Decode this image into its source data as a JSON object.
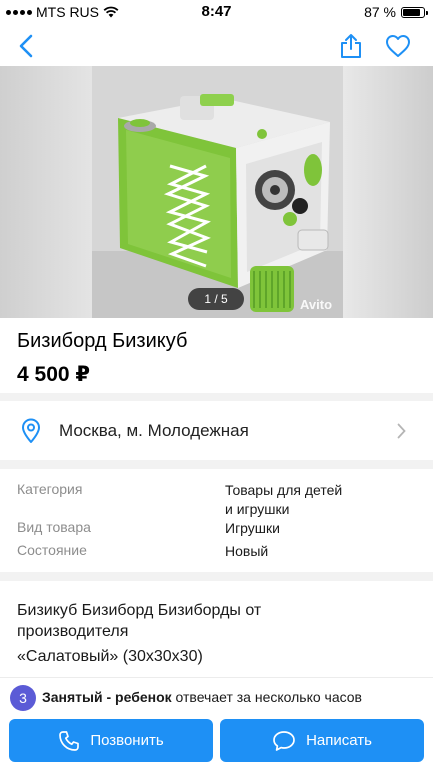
{
  "status": {
    "carrier": "MTS RUS",
    "time": "8:47",
    "battery_percent": "87 %",
    "battery_level": 0.87
  },
  "nav": {
    "back_icon": "chevron-left-icon",
    "share_icon": "share-icon",
    "favorite_icon": "heart-icon",
    "accent_color": "#1e90f5"
  },
  "gallery": {
    "counter": "1 / 5",
    "watermark": "Avito"
  },
  "listing": {
    "title": "Бизиборд Бизикуб",
    "price": "4 500 ₽"
  },
  "location": {
    "text": "Москва, м. Молодежная",
    "icon": "map-pin-icon"
  },
  "params": [
    {
      "label": "Категория",
      "value_line1": "Товары для детей",
      "value_line2": "и игрушки"
    },
    {
      "label": "Вид товара",
      "value": "Игрушки"
    },
    {
      "label": "Состояние",
      "value": "Новый"
    }
  ],
  "description": {
    "line1": "Бизикуб Бизиборд Бизиборды  от производителя",
    "line2": "«Салатовый» (30x30x30)"
  },
  "seller": {
    "badge": "3",
    "name": "Занятый - ребенок",
    "response": " отвечает за несколько часов"
  },
  "actions": {
    "call_label": "Позвонить",
    "message_label": "Написать",
    "button_color": "#1e90f5"
  }
}
